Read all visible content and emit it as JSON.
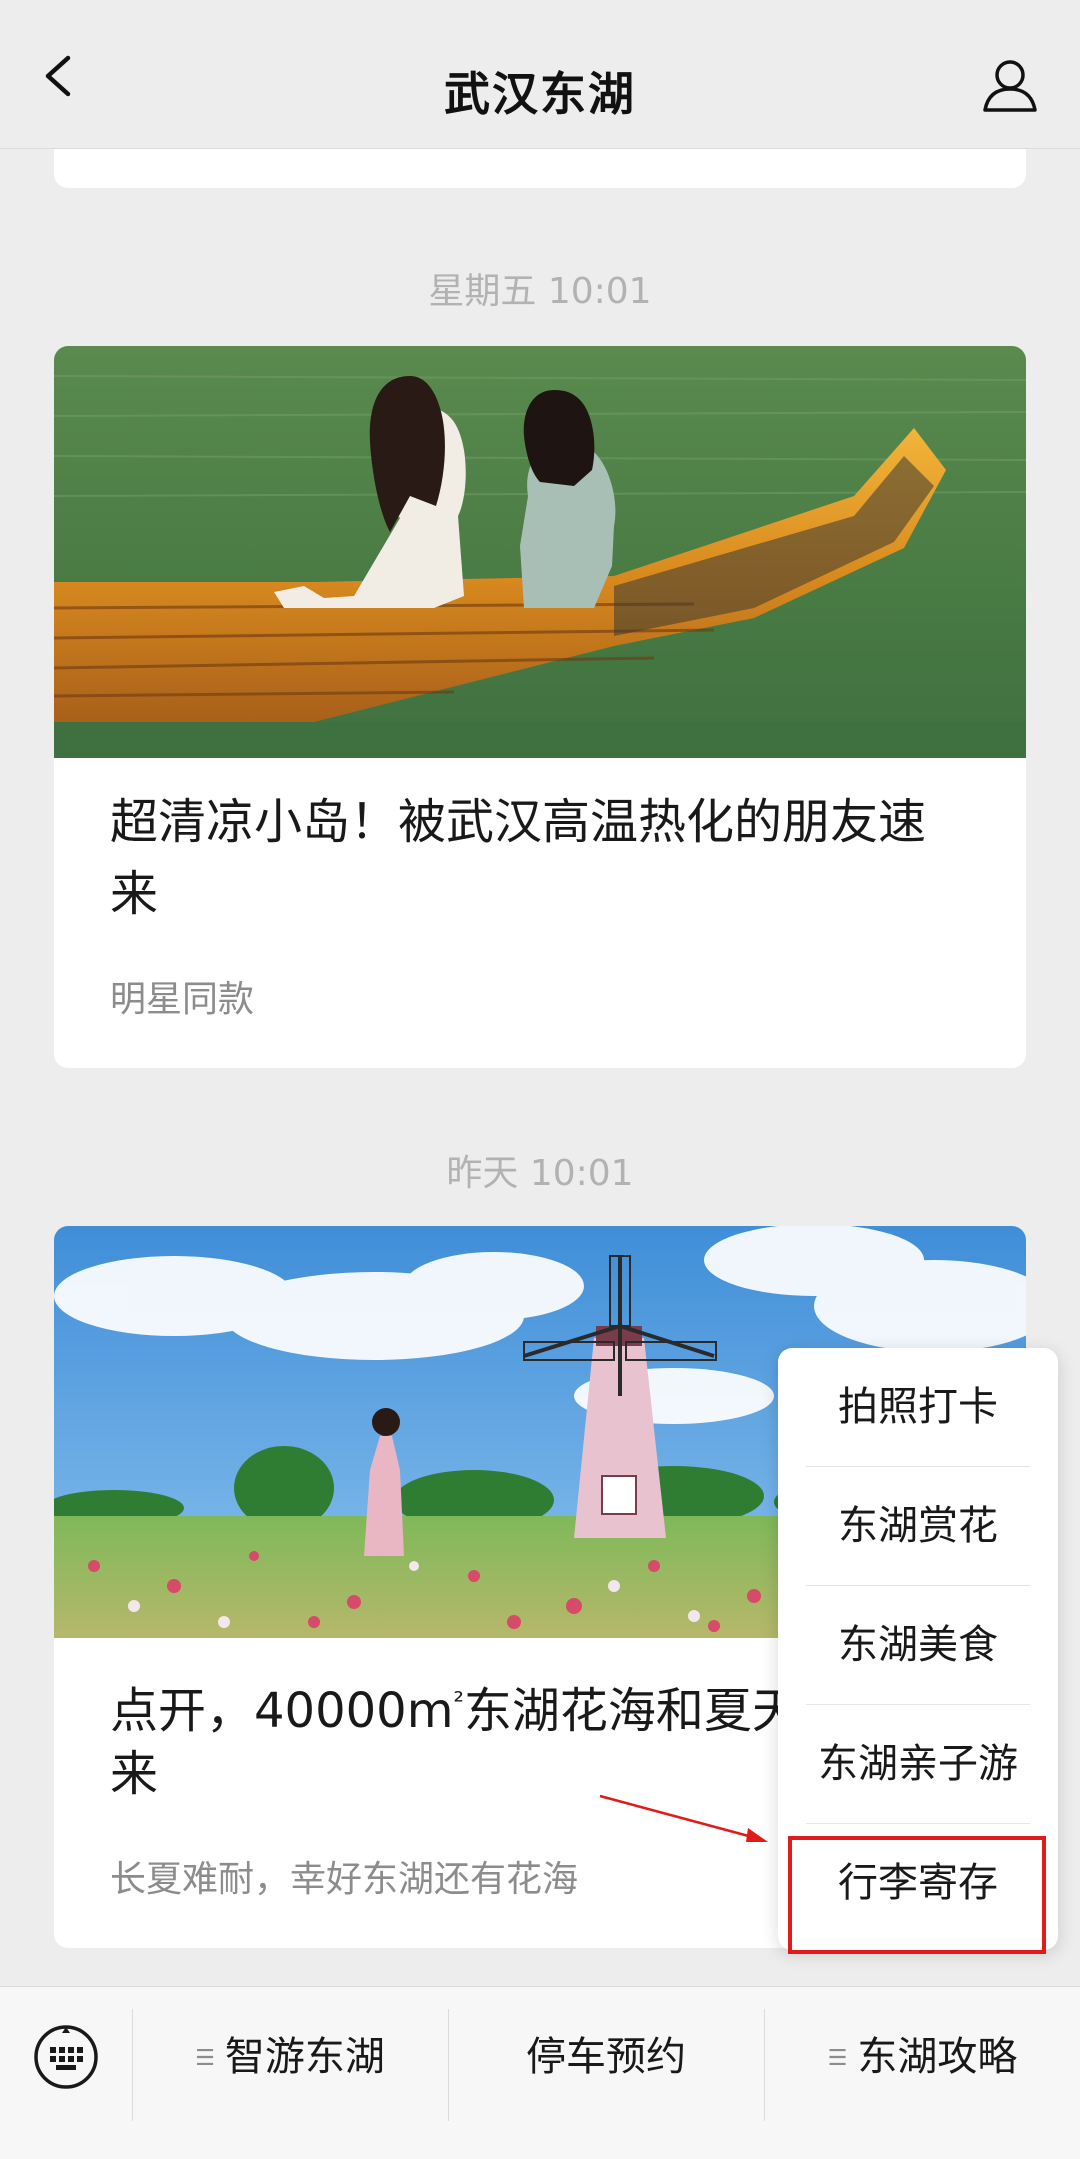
{
  "nav": {
    "title": "武汉东湖",
    "back_icon": "back-arrow-icon",
    "user_icon": "user-icon"
  },
  "feed": [
    {
      "timestamp": "星期五 10:01",
      "image": "girls-on-bamboo-raft",
      "title": "超清凉小岛！被武汉高温热化的朋友速来",
      "digest": "明星同款"
    },
    {
      "timestamp": "昨天 10:01",
      "image": "windmill-flower-field",
      "title_prefix": "点开，40000m",
      "title_sup": "²",
      "title_suffix": "东湖花海和夏天",
      "title_line2": "来",
      "digest": "长夏难耐，幸好东湖还有花海"
    }
  ],
  "popup_menu": {
    "items": [
      "拍照打卡",
      "东湖赏花",
      "东湖美食",
      "东湖亲子游",
      "行李寄存"
    ],
    "highlighted": "行李寄存",
    "highlight_color": "#e11a1a"
  },
  "bottom_bar": {
    "keyboard_icon": "keyboard-icon",
    "items": [
      {
        "label": "智游东湖",
        "has_submenu": true
      },
      {
        "label": "停车预约",
        "has_submenu": false
      },
      {
        "label": "东湖攻略",
        "has_submenu": true
      }
    ]
  }
}
